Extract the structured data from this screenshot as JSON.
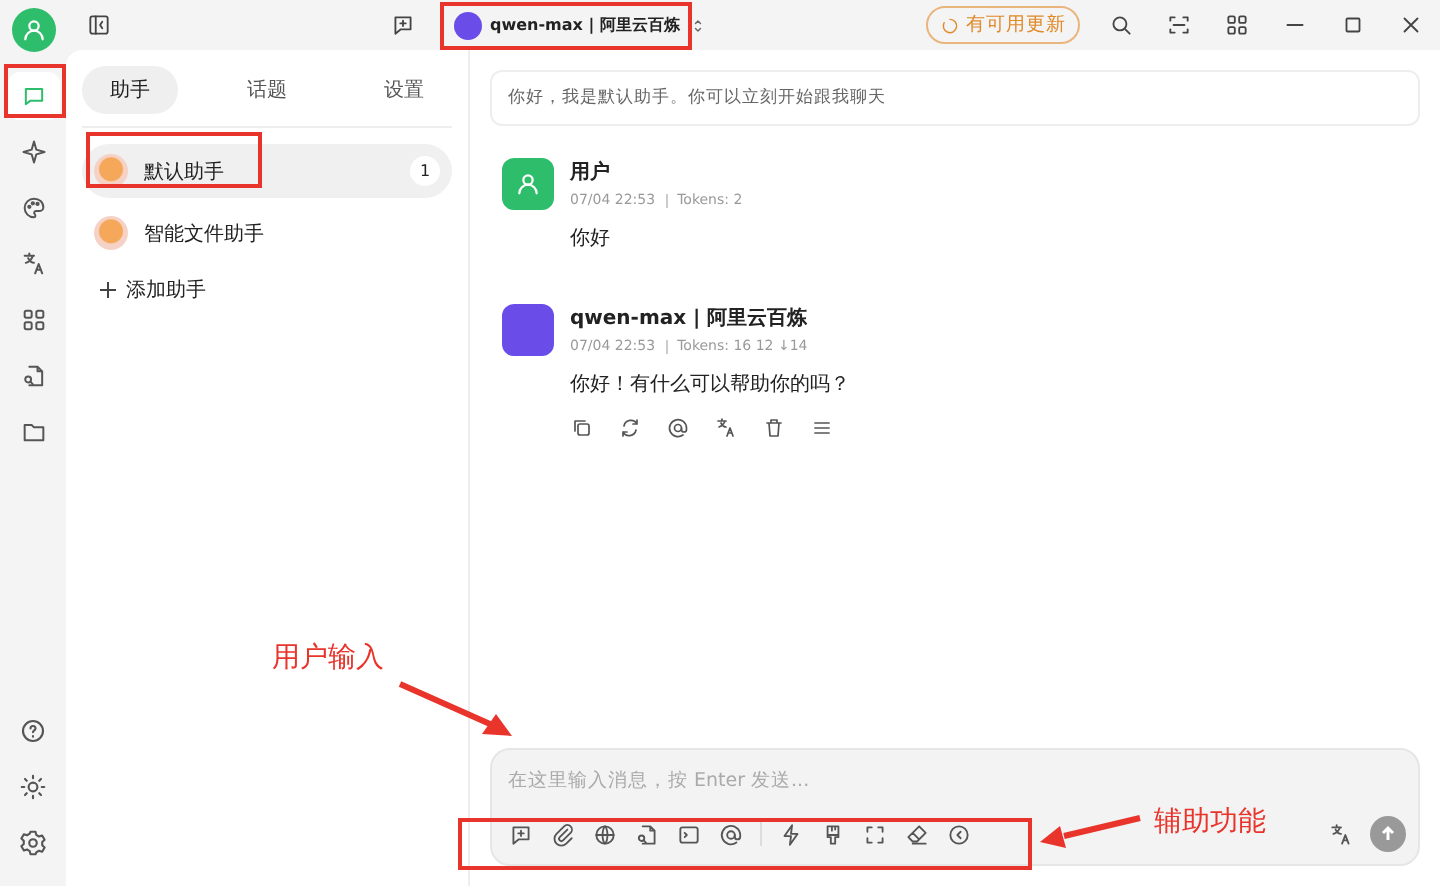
{
  "rail": {
    "items": [
      {
        "selected": true
      },
      {
        "selected": false
      },
      {
        "selected": false
      },
      {
        "selected": false
      },
      {
        "selected": false
      },
      {
        "selected": false
      },
      {
        "selected": false
      }
    ]
  },
  "topbar": {
    "model": "qwen-max | 阿里云百炼",
    "update_badge": "有可用更新"
  },
  "tabs": [
    {
      "label": "助手",
      "selected": true
    },
    {
      "label": "话题",
      "selected": false
    },
    {
      "label": "设置",
      "selected": false
    }
  ],
  "assistants": [
    {
      "name": "默认助手",
      "count": "1",
      "selected": true
    },
    {
      "name": "智能文件助手",
      "selected": false
    }
  ],
  "add_assistant": "添加助手",
  "system_prompt": "你好，我是默认助手。你可以立刻开始跟我聊天",
  "messages": [
    {
      "kind": "user",
      "author": "用户",
      "time": "07/04 22:53",
      "tokens": "Tokens: 2",
      "text": "你好"
    },
    {
      "kind": "assistant",
      "author": "qwen-max | 阿里云百炼",
      "time": "07/04 22:53",
      "tokens": "Tokens: 16 12 ↓14",
      "text": "你好！有什么可以帮助你的吗？"
    }
  ],
  "input": {
    "placeholder": "在这里输入消息，按 Enter 发送..."
  },
  "annotations": [
    {
      "text": "用户输入"
    },
    {
      "text": "辅助功能"
    }
  ]
}
